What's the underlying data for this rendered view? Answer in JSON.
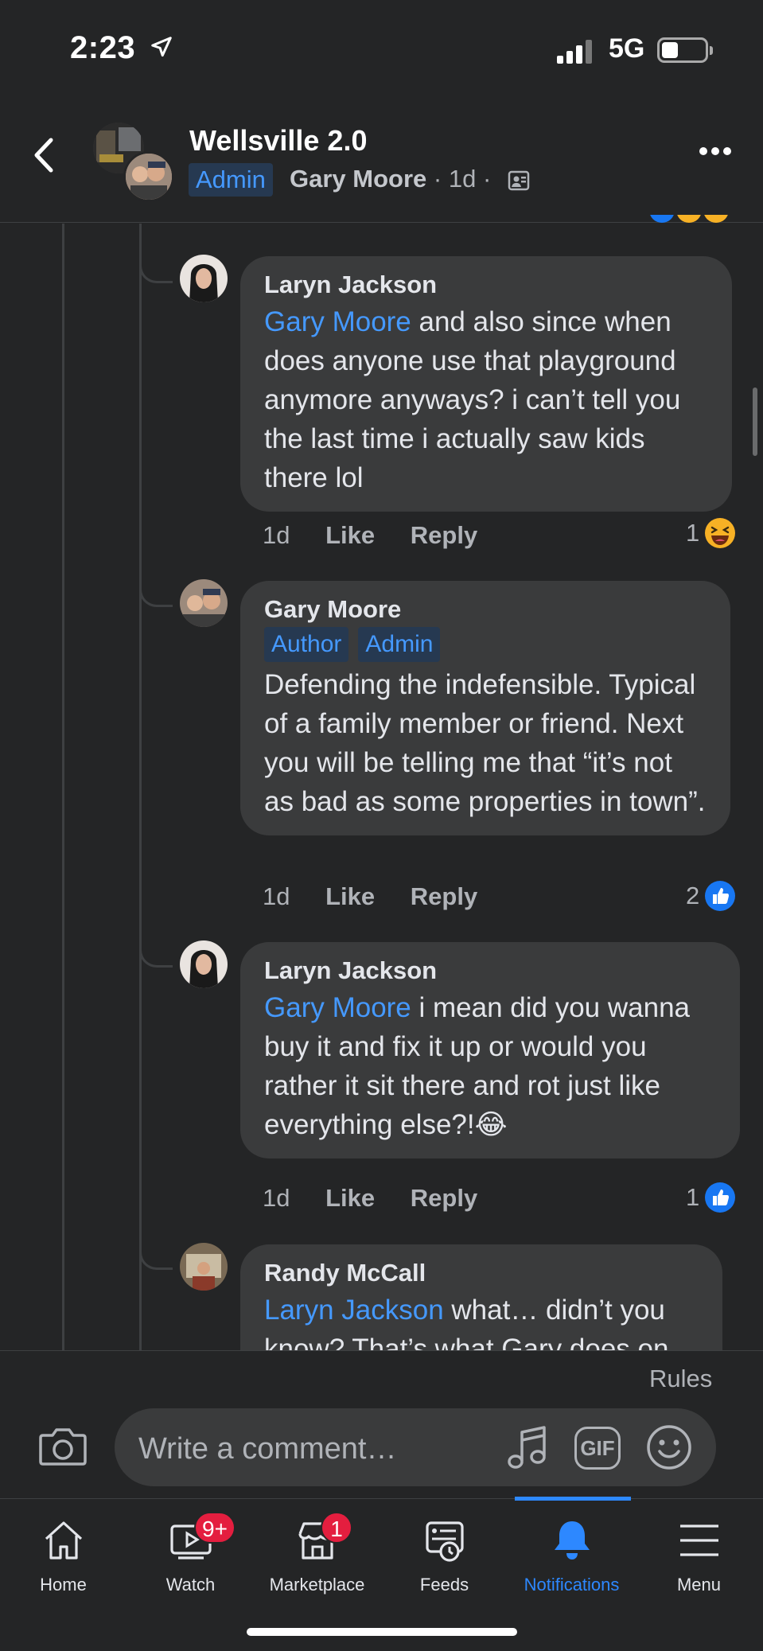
{
  "status": {
    "time": "2:23",
    "network": "5G"
  },
  "header": {
    "title": "Wellsville 2.0",
    "badge": "Admin",
    "author": "Gary Moore",
    "age": "1d"
  },
  "comments": [
    {
      "name": "Laryn Jackson",
      "tags": [],
      "mention": "Gary Moore",
      "text": " and also since when does anyone use that playground anymore anyways? i can’t tell you the last time i actually saw kids there lol",
      "age": "1d",
      "like": "Like",
      "reply": "Reply",
      "reaction_count": "1",
      "reaction_icon": "laugh-emoji-icon"
    },
    {
      "name": "Gary Moore",
      "tags": [
        "Author",
        "Admin"
      ],
      "mention": "",
      "text": "Defending the indefensible. Typical of a family member or friend. Next you will be telling me that “it’s not as bad as some properties in town”.",
      "age": "1d",
      "like": "Like",
      "reply": "Reply",
      "reaction_count": "2",
      "reaction_icon": "like-icon"
    },
    {
      "name": "Laryn Jackson",
      "tags": [],
      "mention": "Gary Moore",
      "text": " i mean did you wanna buy it and fix it up or would you rather it sit there and rot just like everything else?!😂",
      "age": "1d",
      "like": "Like",
      "reply": "Reply",
      "reaction_count": "1",
      "reaction_icon": "like-icon"
    },
    {
      "name": "Randy McCall",
      "tags": [],
      "mention": "Laryn Jackson",
      "text": " what… didn’t you know? That’s what Gary does on",
      "age": "",
      "like": "",
      "reply": "",
      "reaction_count": "",
      "reaction_icon": ""
    }
  ],
  "composer": {
    "rules_label": "Rules",
    "placeholder": "Write a comment…",
    "gif_label": "GIF"
  },
  "tabs": [
    {
      "label": "Home",
      "badge": ""
    },
    {
      "label": "Watch",
      "badge": "9+"
    },
    {
      "label": "Marketplace",
      "badge": "1"
    },
    {
      "label": "Feeds",
      "badge": ""
    },
    {
      "label": "Notifications",
      "badge": ""
    },
    {
      "label": "Menu",
      "badge": ""
    }
  ],
  "colors": {
    "accent": "#2d88ff",
    "mention": "#4599ff",
    "badge_red": "#e41e3f",
    "bubble": "#3a3b3c"
  }
}
